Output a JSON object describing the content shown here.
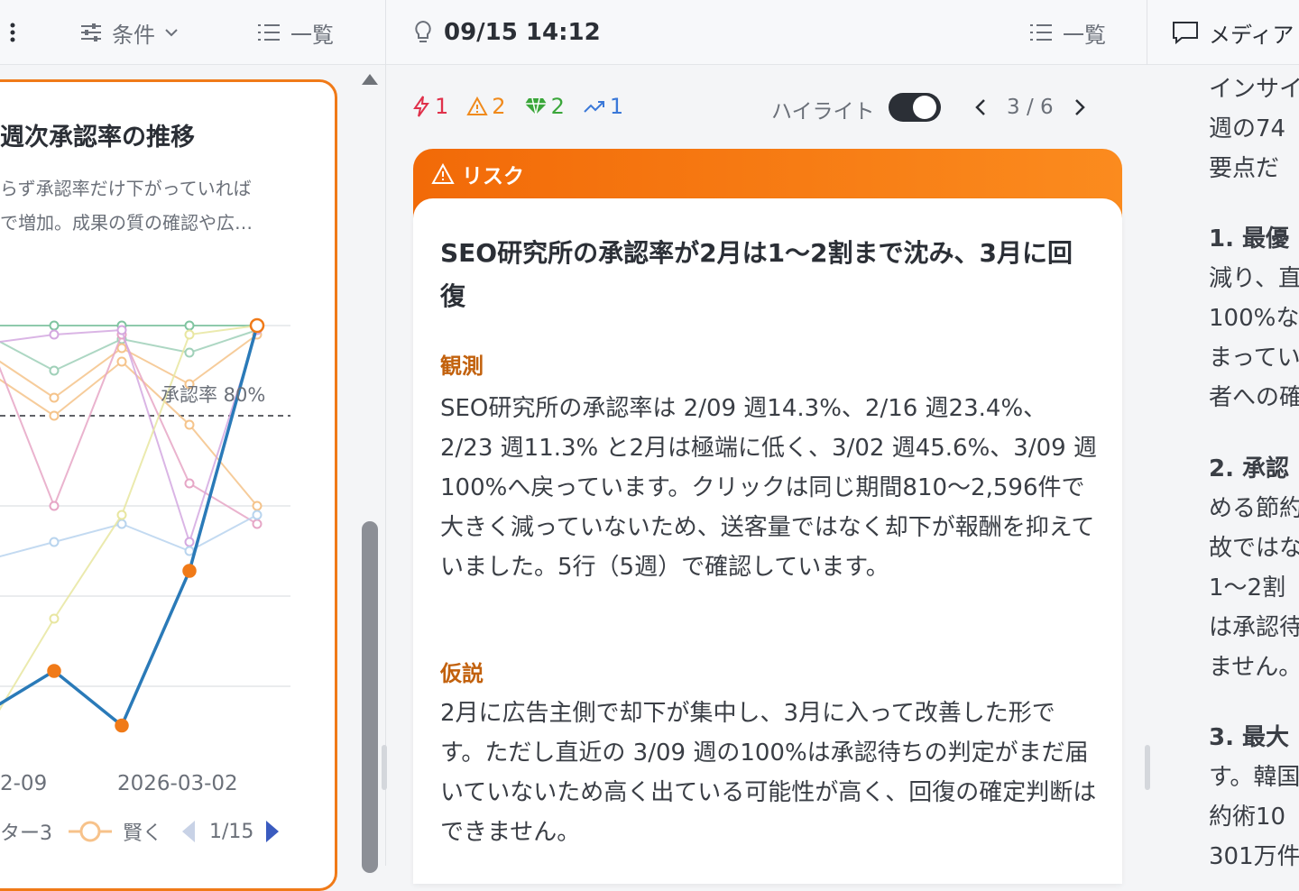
{
  "header": {
    "menu_icon": "kebab-icon",
    "filter_label": "条件",
    "list_label_left": "一覧",
    "timestamp": "09/15 14:12",
    "list_label_mid": "一覧",
    "media_label": "メディア"
  },
  "chart_panel": {
    "title": "週次承認率の推移",
    "desc_line1": "らず承認率だけ下がっていれば",
    "desc_line2": "で増加。成果の質の確認や広…",
    "threshold_label": "承認率 80%",
    "x_ticks": [
      "2-09",
      "2026-03-02"
    ],
    "legend_item1": "ター3",
    "legend_item2": "賢く",
    "legend_page": "1/15",
    "chart_data": {
      "type": "line",
      "x": [
        "2026-02-09",
        "2026-02-16",
        "2026-02-23",
        "2026-03-02",
        "2026-03-09"
      ],
      "highlight_series": {
        "name": "SEO研究所",
        "values": [
          14.3,
          23.4,
          11.3,
          45.6,
          100
        ]
      },
      "reference_line": 80,
      "ylim": [
        0,
        100
      ]
    }
  },
  "insight": {
    "badge_risk": "1",
    "badge_warn": "2",
    "badge_gem": "2",
    "badge_trend": "1",
    "highlight_label": "ハイライト",
    "highlight_on": true,
    "pager": "3 / 6",
    "category": "リスク",
    "title": "SEO研究所の承認率が2月は1～2割まで沈み、3月に回復",
    "observation_label": "観測",
    "observation_text": "SEO研究所の承認率は 2/09 週14.3%、2/16 週23.4%、2/23 週11.3% と2月は極端に低く、3/02 週45.6%、3/09 週100%へ戻っています。クリックは同じ期間810～2,596件で大きく減っていないため、送客量ではなく却下が報酬を抑えていました。5行（5週）で確認しています。",
    "hypothesis_label": "仮説",
    "hypothesis_text": "2月に広告主側で却下が集中し、3月に入って改善した形です。ただし直近の 3/09 週の100%は承認待ちの判定がまだ届いていないため高く出ている可能性が高く、回復の確定判断はできません。"
  },
  "right_panel": {
    "lines": [
      "インサイ",
      "週の74",
      "要点だ",
      "",
      "1. 最優",
      "減り、直",
      "100%な",
      "まってい",
      "者への確",
      "",
      "2. 承認",
      "める節約",
      "故ではな",
      "1～2割",
      "は承認待",
      "ません。",
      "",
      "3. 最大",
      "す。韓国",
      "約術10",
      "301万件"
    ]
  },
  "colors": {
    "accent": "#f07a18",
    "highlight_line": "#2a7ab8",
    "risk": "#e0314b",
    "warn": "#f08a1c",
    "gem": "#3aa63a",
    "trend": "#3a78d8"
  }
}
